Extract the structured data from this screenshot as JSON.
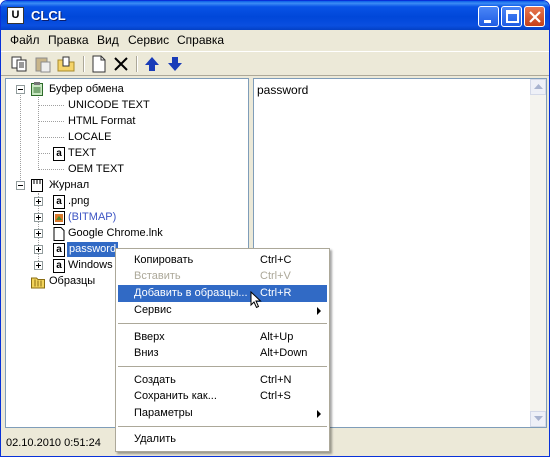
{
  "window": {
    "title": "CLCL",
    "app_glyph": "U"
  },
  "menubar": [
    "Файл",
    "Правка",
    "Вид",
    "Сервис",
    "Справка"
  ],
  "toolbar_icons": [
    "copy-icon",
    "paste-icon",
    "folder-icon",
    "new-item-icon",
    "delete-icon",
    "move-up-icon",
    "move-down-icon"
  ],
  "tree": {
    "clipboard": {
      "label": "Буфер обмена",
      "children": [
        "UNICODE TEXT",
        "HTML Format",
        "LOCALE",
        "TEXT",
        "OEM TEXT"
      ]
    },
    "journal": {
      "label": "Журнал",
      "children": [
        ".png",
        "(BITMAP)",
        "Google Chrome.lnk",
        "password",
        "Windows"
      ]
    },
    "templates": {
      "label": "Образцы"
    }
  },
  "text_pane": {
    "content": "password"
  },
  "status": {
    "text": "02.10.2010 0:51:24"
  },
  "context_menu": {
    "items": [
      {
        "label": "Копировать",
        "accel": "Ctrl+C",
        "state": "normal"
      },
      {
        "label": "Вставить",
        "accel": "Ctrl+V",
        "state": "disabled"
      },
      {
        "label": "Добавить в образцы...",
        "accel": "Ctrl+R",
        "state": "hover"
      },
      {
        "label": "Сервис",
        "accel": "",
        "state": "submenu"
      },
      {
        "label": "Вверх",
        "accel": "Alt+Up",
        "state": "normal"
      },
      {
        "label": "Вниз",
        "accel": "Alt+Down",
        "state": "normal"
      },
      {
        "label": "Создать",
        "accel": "Ctrl+N",
        "state": "normal"
      },
      {
        "label": "Сохранить как...",
        "accel": "Ctrl+S",
        "state": "normal"
      },
      {
        "label": "Параметры",
        "accel": "",
        "state": "submenu"
      },
      {
        "label": "Удалить",
        "accel": "",
        "state": "normal"
      }
    ]
  },
  "colors": {
    "selection": "#316ac5",
    "titlebar": "#0047d9",
    "link_blue": "#3d55c4"
  }
}
